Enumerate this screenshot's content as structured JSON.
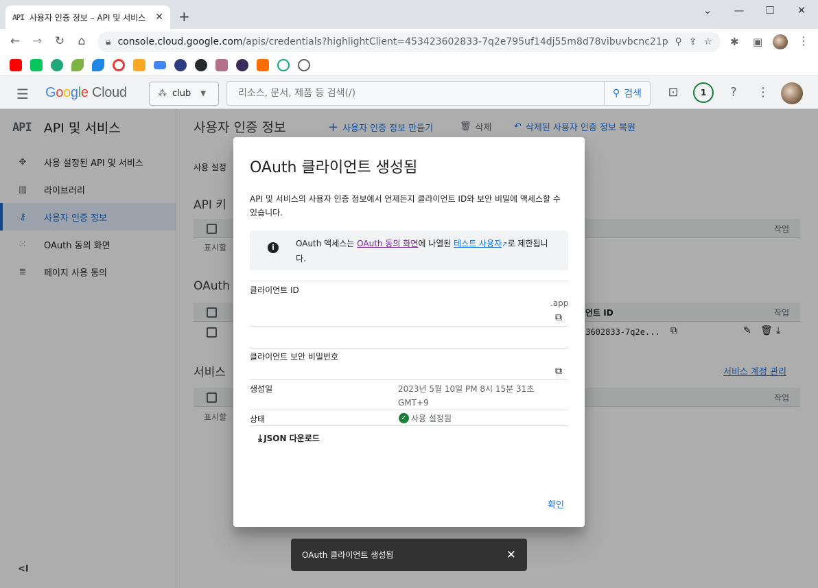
{
  "browser": {
    "tab_title": "사용자 인증 정보 – API 및 서비스",
    "tab_favicon": "API",
    "url_host": "console.cloud.google.com",
    "url_path": "/apis/credentials?highlightClient=453423602833-7q2e795uf14dj55m8d78vibuvbcnc21p.apps.g..."
  },
  "header": {
    "logo_google": "Google",
    "logo_cloud": "Cloud",
    "project": "club",
    "search_placeholder": "리소스, 문서, 제품 등 검색(/)",
    "search_button": "검색",
    "notification_count": "1"
  },
  "sidebar": {
    "title_icon": "API",
    "title": "API 및 서비스",
    "items": [
      {
        "label": "사용 설정된 API 및 서비스",
        "icon": "diamond-icon"
      },
      {
        "label": "라이브러리",
        "icon": "library-icon"
      },
      {
        "label": "사용자 인증 정보",
        "icon": "key-icon"
      },
      {
        "label": "OAuth 동의 화면",
        "icon": "dots-icon"
      },
      {
        "label": "페이지 사용 동의",
        "icon": "settings-list-icon"
      }
    ],
    "collapse": "<I"
  },
  "main": {
    "title": "사용자 인증 정보",
    "actions": {
      "create": "사용자 인증 정보 만들기",
      "delete": "삭제",
      "restore": "삭제된 사용자 인증 정보 복원"
    },
    "intro": "사용 설정",
    "api_keys_title": "API 키",
    "oauth_title": "OAuth 2",
    "service_title": "서비스",
    "service_manage": "서비스 계정 관리",
    "col_action": "작업",
    "col_client_id": "언트 ID",
    "client_id_trunc": "23602833-7q2e...",
    "show": "표시할"
  },
  "dialog": {
    "title": "OAuth 클라이언트 생성됨",
    "desc": "API 및 서비스의 사용자 인증 정보에서 언제든지 클라이언트 ID와 보안 비밀에 액세스할 수 있습니다.",
    "info_1": "OAuth 액세스는 ",
    "info_link1": "OAuth 동의 화면",
    "info_2": "에 나열된 ",
    "info_link2": "테스트 사용자",
    "info_3": "로 제한됩니다.",
    "client_id_label": "클라이언트 ID",
    "client_id_suffix": ".app",
    "secret_label": "클라이언트 보안 비밀번호",
    "created_label": "생성일",
    "created_value": "2023년 5월 10일 PM 8시 15분 31초 GMT+9",
    "status_label": "상태",
    "status_value": "사용 설정됨",
    "download": "JSON 다운로드",
    "confirm": "확인"
  },
  "snackbar": {
    "text": "OAuth 클라이언트 생성됨"
  },
  "colors": {
    "accent": "#1a73e8",
    "success": "#188038",
    "visited": "#7b1fa2"
  }
}
